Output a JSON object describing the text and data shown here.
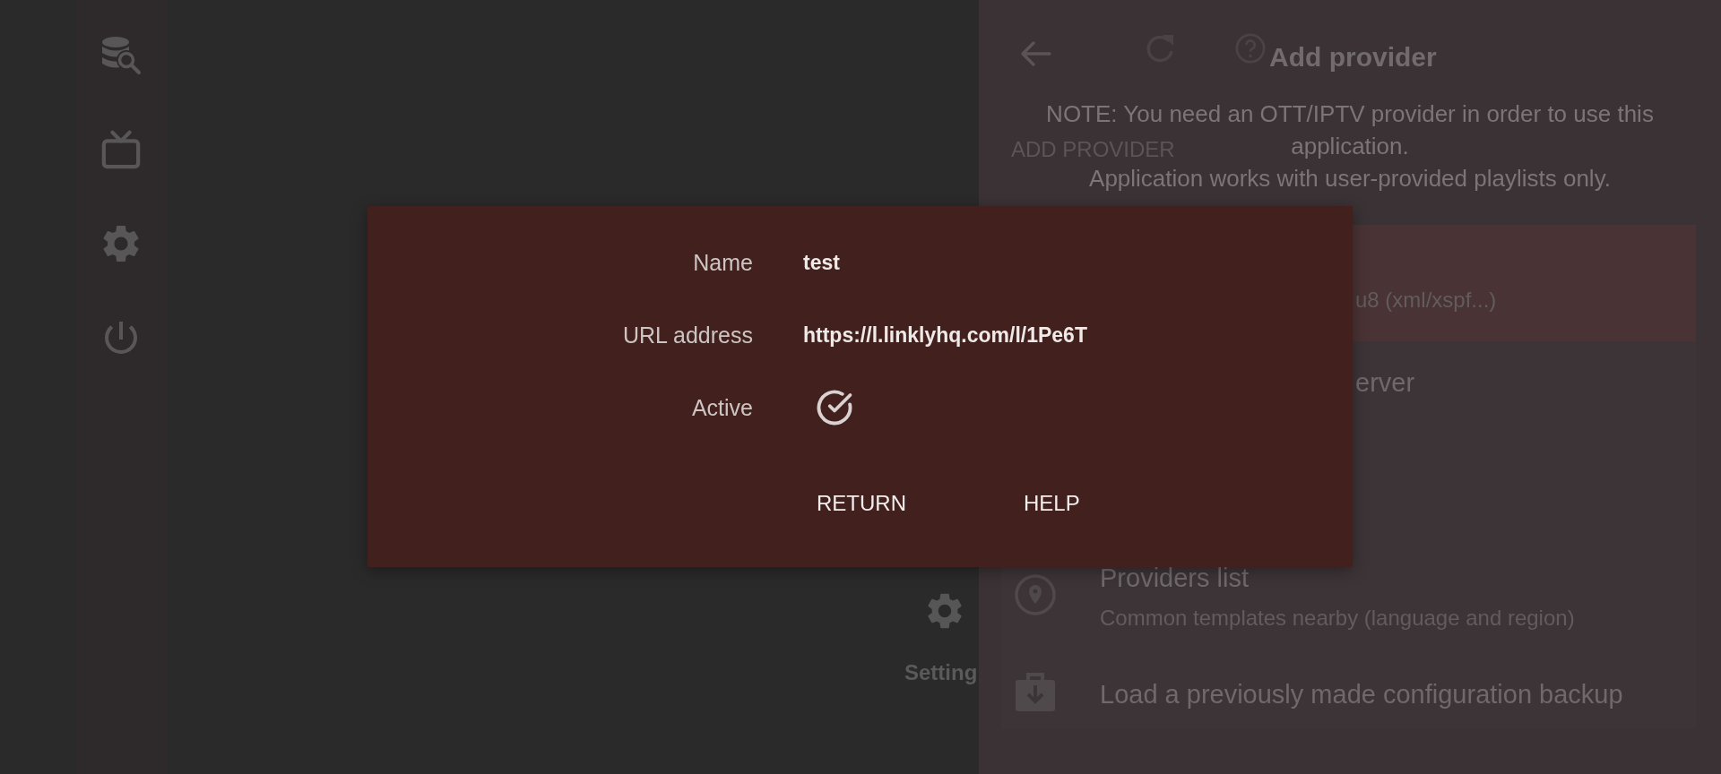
{
  "home": {
    "tiles": [
      {
        "label": "Setting"
      }
    ]
  },
  "provider_panel": {
    "heading": "ADD PROVIDER",
    "title": "Add provider",
    "note_lines": [
      "NOTE: You need an OTT/IPTV provider in order to use this",
      "application.",
      "Application works with user-provided playlists only."
    ],
    "options": [
      {
        "subtitle": "u8 (xml/xspf...)",
        "selected": true
      },
      {
        "title": "erver",
        "selected": false
      },
      {
        "title": "Providers list",
        "subtitle": "Common templates nearby (language and region)",
        "selected": false
      },
      {
        "title": "Load a previously made configuration backup",
        "selected": false
      }
    ]
  },
  "dialog": {
    "fields": [
      {
        "kind": "text",
        "label": "Name",
        "value": "test"
      },
      {
        "kind": "text",
        "label": "URL address",
        "value": "https://l.linklyhq.com/l/1Pe6T"
      },
      {
        "kind": "checkbox",
        "label": "Active",
        "checked": true
      }
    ],
    "buttons": [
      "RETURN",
      "HELP"
    ]
  }
}
